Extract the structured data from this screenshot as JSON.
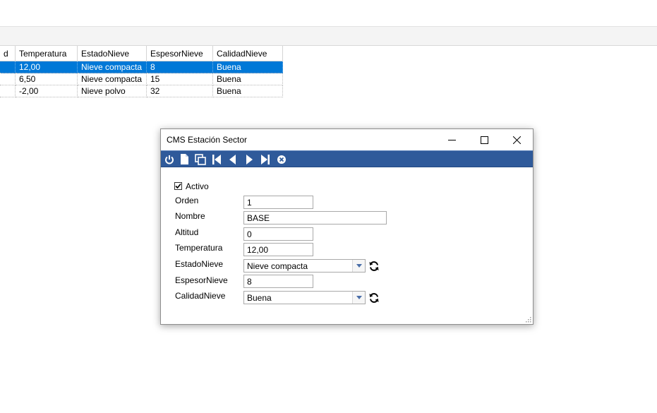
{
  "grid": {
    "columns": [
      "d",
      "Temperatura",
      "EstadoNieve",
      "EspesorNieve",
      "CalidadNieve"
    ],
    "rows": [
      [
        "",
        "12,00",
        "Nieve compacta",
        "8",
        "Buena"
      ],
      [
        "",
        "6,50",
        "Nieve compacta",
        "15",
        "Buena"
      ],
      [
        "",
        "-2,00",
        "Nieve polvo",
        "32",
        "Buena"
      ]
    ],
    "selected_row": 0
  },
  "dialog": {
    "title": "CMS Estación Sector",
    "minimize_glyph": "—",
    "maximize_glyph": "☐",
    "close_glyph": "✕",
    "toolbar": [
      "power-icon",
      "new-document-icon",
      "copy-icon",
      "first-record-icon",
      "previous-record-icon",
      "next-record-icon",
      "last-record-icon",
      "cancel-icon"
    ],
    "form": {
      "activo_label": "Activo",
      "activo_checked": true,
      "orden_label": "Orden",
      "orden_value": "1",
      "nombre_label": "Nombre",
      "nombre_value": "BASE",
      "altitud_label": "Altitud",
      "altitud_value": "0",
      "temperatura_label": "Temperatura",
      "temperatura_value": "12,00",
      "estado_label": "EstadoNieve",
      "estado_value": "Nieve compacta",
      "espesor_label": "EspesorNieve",
      "espesor_value": "8",
      "calidad_label": "CalidadNieve",
      "calidad_value": "Buena"
    }
  },
  "colors": {
    "toolbar": "#2f5a9a",
    "selection": "#0078d7"
  }
}
